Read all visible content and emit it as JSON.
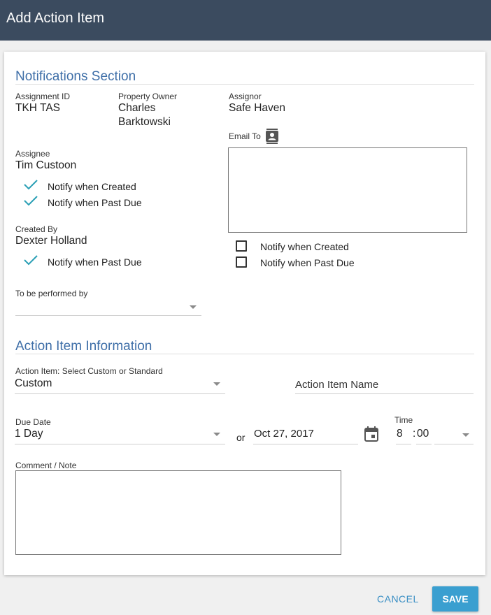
{
  "header": {
    "title": "Add Action Item"
  },
  "notifications": {
    "title": "Notifications Section",
    "assignment_id": {
      "label": "Assignment ID",
      "value": "TKH TAS"
    },
    "property_owner": {
      "label": "Property Owner",
      "value_line1": "Charles",
      "value_line2": "Barktowski"
    },
    "assignor": {
      "label": "Assignor",
      "value": "Safe Haven"
    },
    "email_to": {
      "label": "Email To",
      "value": ""
    },
    "assignee": {
      "label": "Assignee",
      "value": "Tim Custoon",
      "notify_created": {
        "label": "Notify when Created",
        "checked": true
      },
      "notify_past_due": {
        "label": "Notify when Past Due",
        "checked": true
      }
    },
    "created_by": {
      "label": "Created By",
      "value": "Dexter Holland",
      "notify_past_due": {
        "label": "Notify when Past Due",
        "checked": true
      }
    },
    "email_notify_created": {
      "label": "Notify when Created",
      "checked": false
    },
    "email_notify_past_due": {
      "label": "Notify when Past Due",
      "checked": false
    },
    "performed_by": {
      "label": "To be performed by",
      "value": ""
    }
  },
  "action_item": {
    "title": "Action Item Information",
    "type": {
      "label": "Action Item: Select Custom or Standard",
      "value": "Custom"
    },
    "name": {
      "placeholder": "Action Item Name"
    },
    "due_date": {
      "label": "Due Date",
      "value": "1 Day"
    },
    "or_text": "or",
    "date": {
      "value": "Oct 27, 2017"
    },
    "time": {
      "label": "Time",
      "hour": "8",
      "separator": ":",
      "minute": "00",
      "ampm": ""
    },
    "comment": {
      "label": "Comment / Note",
      "value": ""
    }
  },
  "footer": {
    "cancel_label": "CANCEL",
    "save_label": "SAVE"
  },
  "colors": {
    "header_bg": "#3b4b5f",
    "section_title": "#3f6fa8",
    "check": "#2a9fb5",
    "save_bg": "#3a9fd0",
    "cancel_text": "#3a8fc4"
  },
  "icons": {
    "contact": "contact-card-icon",
    "calendar": "calendar-icon",
    "check": "checkmark-icon"
  }
}
